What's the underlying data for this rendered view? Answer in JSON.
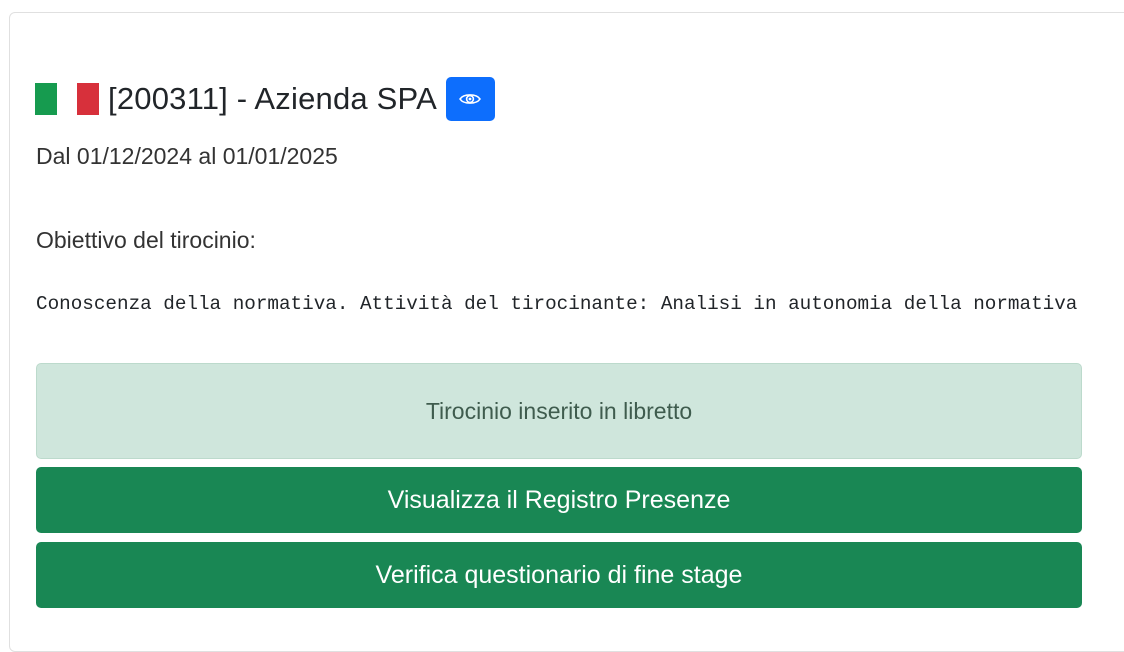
{
  "header": {
    "title": "[200311] - Azienda SPA",
    "flag_colors": {
      "green": "#169b4f",
      "red": "#d7303b"
    },
    "view_icon": "eye-icon",
    "view_button_color": "#0d6efd"
  },
  "period": {
    "text": "Dal 01/12/2024 al 01/01/2025"
  },
  "objective": {
    "label": "Obiettivo del tirocinio:",
    "text": "Conoscenza della normativa. Attività del tirocinante: Analisi in autonomia della normativa"
  },
  "status": {
    "text": "Tirocinio inserito in libretto",
    "bg_color": "#cfe6dc"
  },
  "actions": {
    "registro_label": "Visualizza il Registro Presenze",
    "questionario_label": "Verifica questionario di fine stage",
    "button_color": "#198754"
  }
}
